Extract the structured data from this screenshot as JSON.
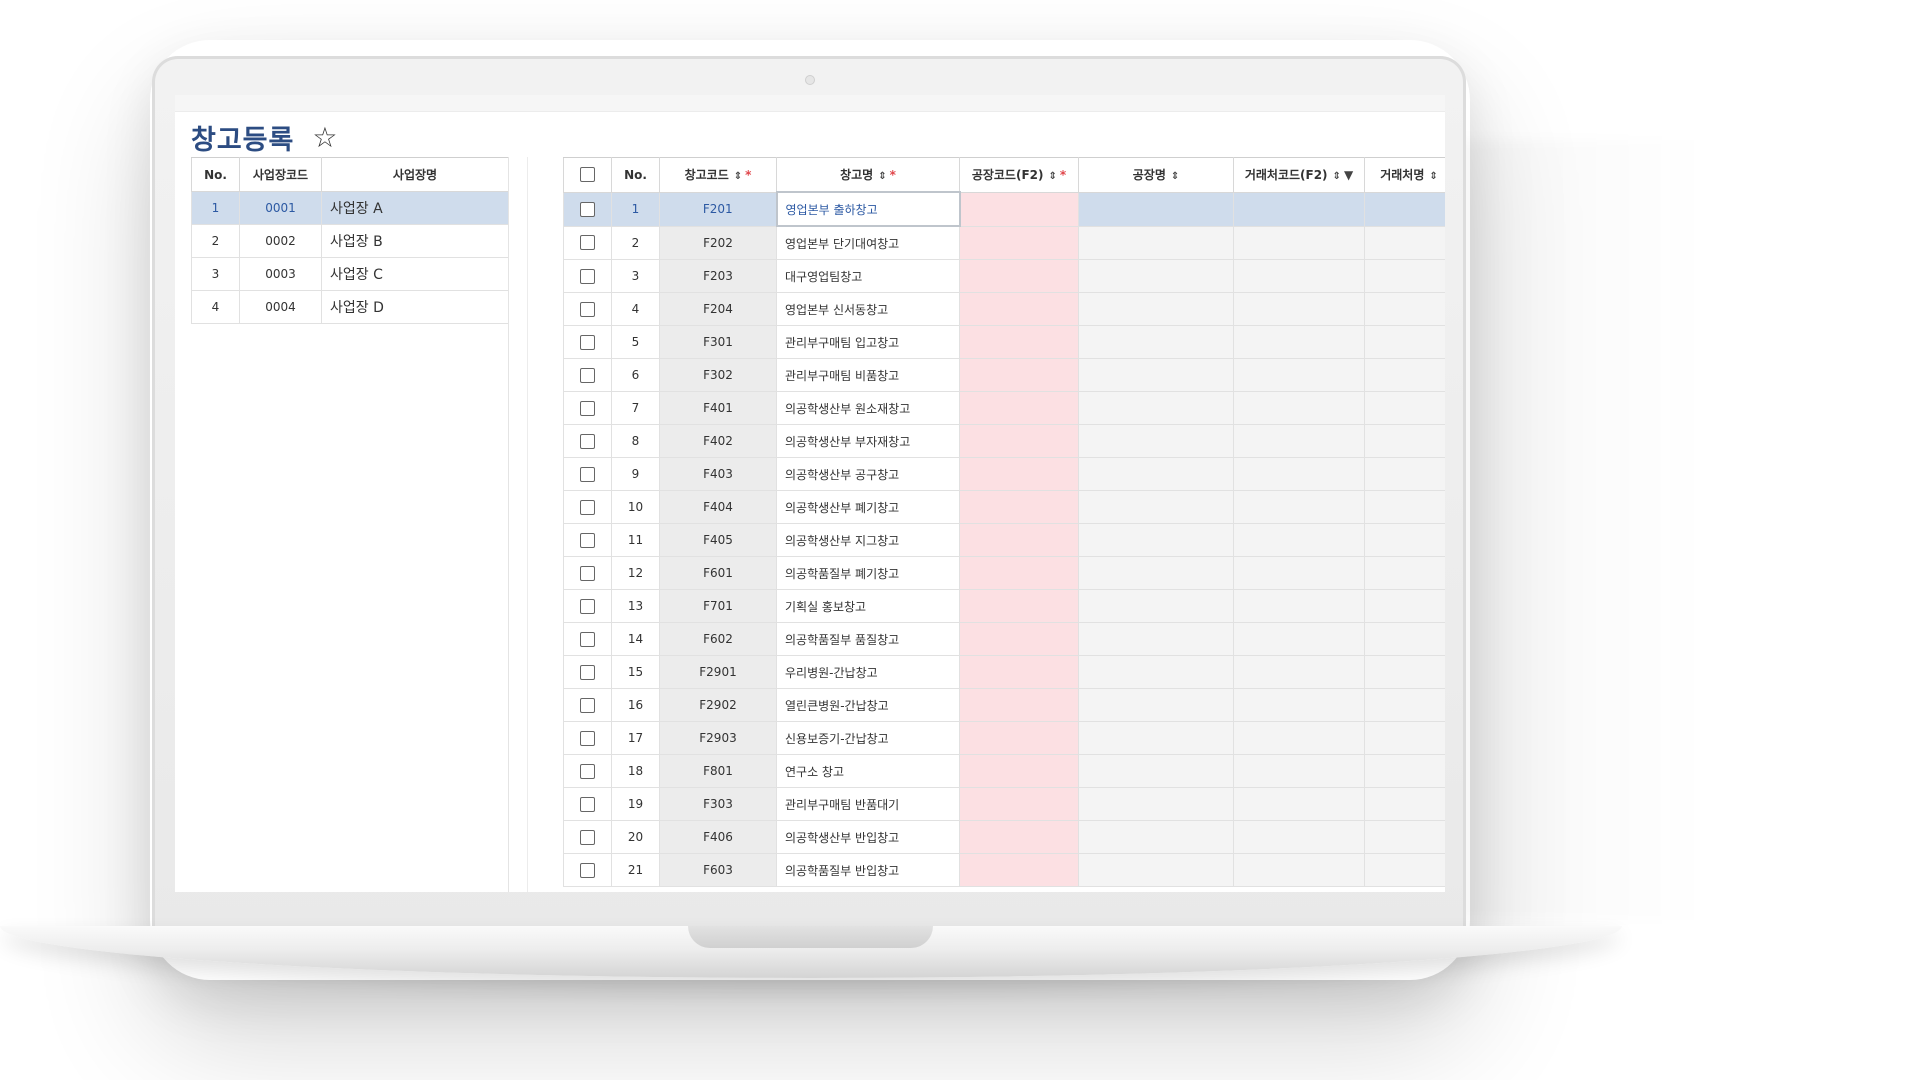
{
  "page": {
    "title": "창고등록"
  },
  "left_table": {
    "headers": [
      "No.",
      "사업장코드",
      "사업장명"
    ],
    "rows": [
      {
        "no": "1",
        "code": "0001",
        "name": "사업장 A"
      },
      {
        "no": "2",
        "code": "0002",
        "name": "사업장 B"
      },
      {
        "no": "3",
        "code": "0003",
        "name": "사업장 C"
      },
      {
        "no": "4",
        "code": "0004",
        "name": "사업장 D"
      }
    ],
    "selected_row": 1
  },
  "right_table": {
    "headers": {
      "no": "No.",
      "warehouse_code": "창고코드",
      "warehouse_name": "창고명",
      "factory_code": "공장코드(F2)",
      "factory_name": "공장명",
      "client_code": "거래처코드(F2)",
      "client_name": "거래처명"
    },
    "rows": [
      {
        "no": "1",
        "code": "F201",
        "name": "영업본부 출하창고"
      },
      {
        "no": "2",
        "code": "F202",
        "name": "영업본부 단기대여창고"
      },
      {
        "no": "3",
        "code": "F203",
        "name": "대구영업팀창고"
      },
      {
        "no": "4",
        "code": "F204",
        "name": "영업본부 신서동창고"
      },
      {
        "no": "5",
        "code": "F301",
        "name": "관리부구매팀 입고창고"
      },
      {
        "no": "6",
        "code": "F302",
        "name": "관리부구매팀 비품창고"
      },
      {
        "no": "7",
        "code": "F401",
        "name": "의공학생산부 원소재창고"
      },
      {
        "no": "8",
        "code": "F402",
        "name": "의공학생산부 부자재창고"
      },
      {
        "no": "9",
        "code": "F403",
        "name": "의공학생산부 공구창고"
      },
      {
        "no": "10",
        "code": "F404",
        "name": "의공학생산부 폐기창고"
      },
      {
        "no": "11",
        "code": "F405",
        "name": "의공학생산부 지그창고"
      },
      {
        "no": "12",
        "code": "F601",
        "name": "의공학품질부 폐기창고"
      },
      {
        "no": "13",
        "code": "F701",
        "name": "기획실 홍보창고"
      },
      {
        "no": "14",
        "code": "F602",
        "name": "의공학품질부 품질창고"
      },
      {
        "no": "15",
        "code": "F2901",
        "name": "우리병원-간납창고"
      },
      {
        "no": "16",
        "code": "F2902",
        "name": "열린큰병원-간납창고"
      },
      {
        "no": "17",
        "code": "F2903",
        "name": "신용보증기-간납창고"
      },
      {
        "no": "18",
        "code": "F801",
        "name": "연구소 창고"
      },
      {
        "no": "19",
        "code": "F303",
        "name": "관리부구매팀 반품대기"
      },
      {
        "no": "20",
        "code": "F406",
        "name": "의공학생산부 반입창고"
      },
      {
        "no": "21",
        "code": "F603",
        "name": "의공학품질부 반입창고"
      }
    ],
    "selected_row": 1
  },
  "icons": {
    "favorite": "star-outline-icon",
    "sort": "sort-arrows-icon",
    "filter": "filter-funnel-icon",
    "required": "required-asterisk-icon"
  },
  "colors": {
    "title": "#2c4c82",
    "selected_row": "#cfdcec",
    "required_column": "#fce0e3",
    "code_column": "#ececec",
    "required_mark": "#e0464b"
  }
}
